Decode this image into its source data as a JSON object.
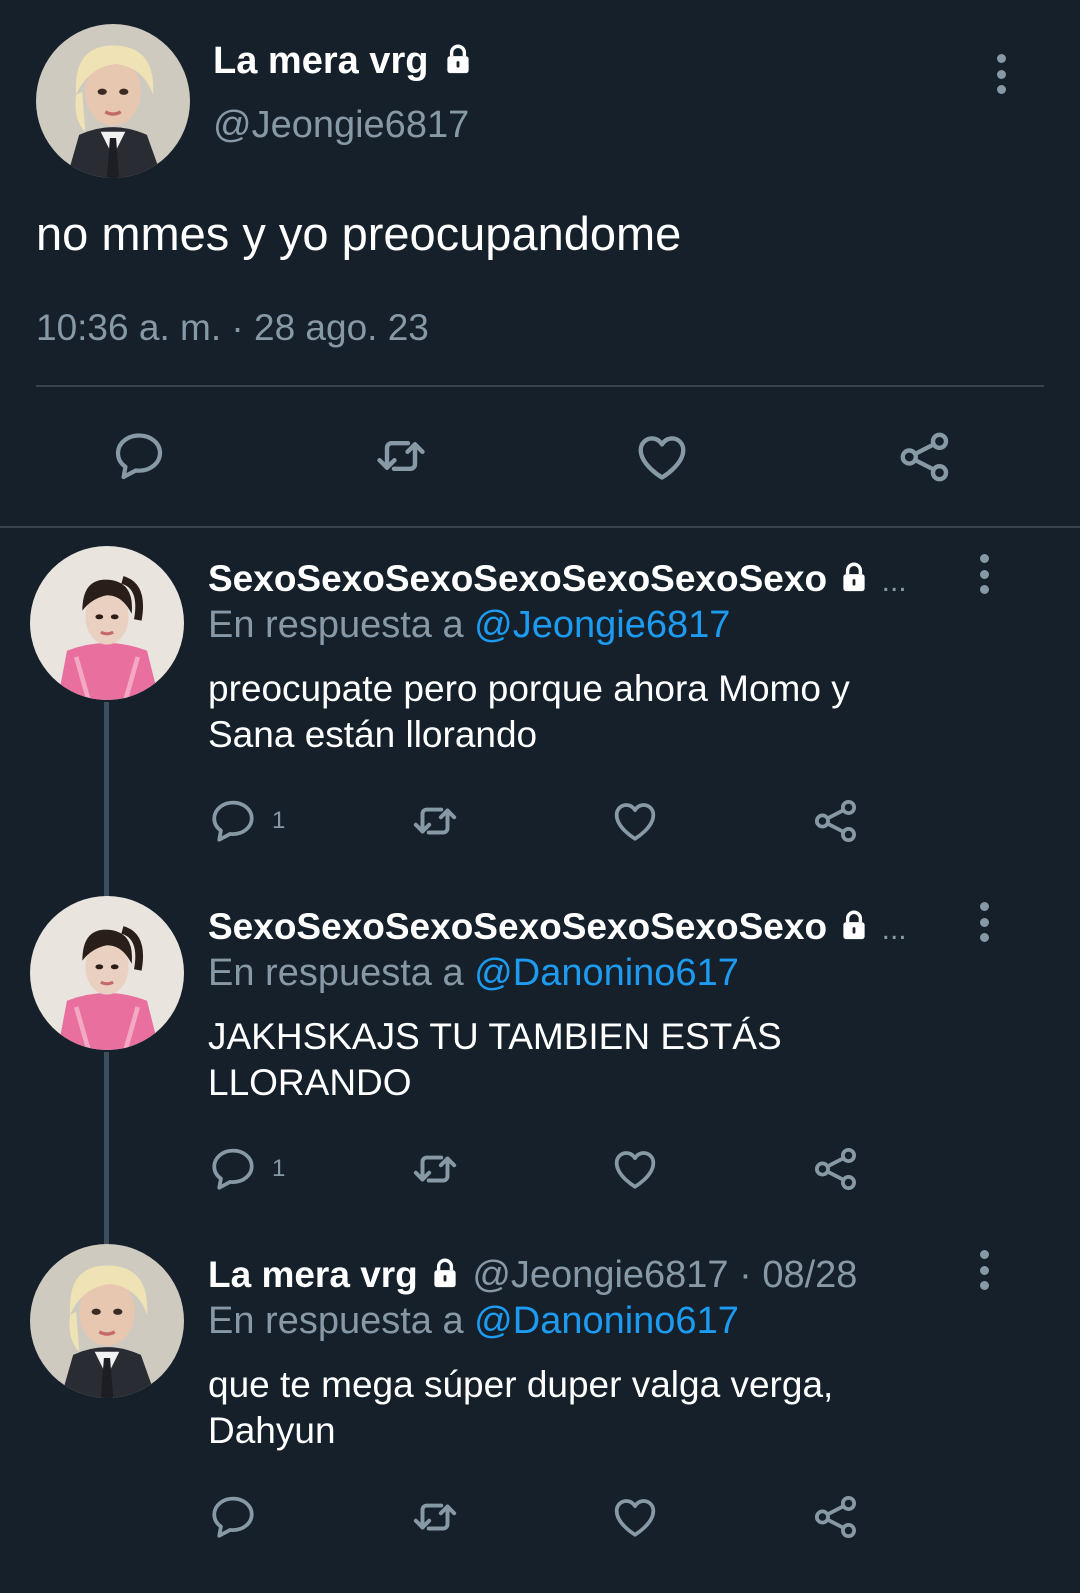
{
  "main_tweet": {
    "display_name": "La mera vrg",
    "handle": "@Jeongie6817",
    "text": "no mmes y yo preocupandome",
    "timestamp": "10:36 a. m. · 28 ago. 23"
  },
  "replies": [
    {
      "display_name": "SexoSexoSexoSexoSexoSexoSexo",
      "ellipsis": "...",
      "reply_prefix": "En respuesta a",
      "reply_to": "@Jeongie6817",
      "text_line1": "preocupate pero porque ahora Momo y",
      "text_line2": "Sana están llorando",
      "reply_count": "1"
    },
    {
      "display_name": "SexoSexoSexoSexoSexoSexoSexo",
      "ellipsis": "...",
      "reply_prefix": "En respuesta a",
      "reply_to": "@Danonino617",
      "text_line1": "JAKHSKAJS TU TAMBIEN ESTÁS",
      "text_line2": "LLORANDO",
      "reply_count": "1"
    },
    {
      "display_name": "La mera vrg",
      "handle_time": "@Jeongie6817 · 08/28",
      "reply_prefix": "En respuesta a",
      "reply_to": "@Danonino617",
      "text_line1": "que te mega súper duper valga verga,",
      "text_line2": "Dahyun"
    }
  ],
  "colors": {
    "background": "#15202b",
    "muted": "#8899a6",
    "link": "#1d9bf0",
    "divider": "#38444d"
  },
  "icons": [
    "lock-icon",
    "more-options-icon",
    "reply-icon",
    "retweet-icon",
    "like-icon",
    "share-icon"
  ]
}
